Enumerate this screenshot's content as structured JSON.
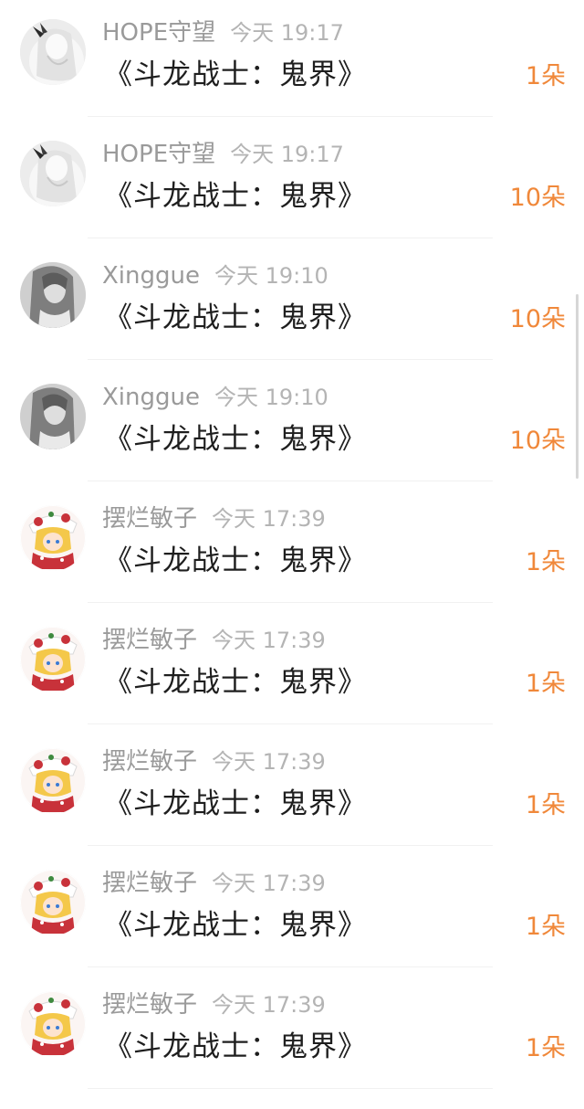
{
  "gift_list": [
    {
      "user": "HOPE守望",
      "time": "今天 19:17",
      "book": "《斗龙战士：鬼界》",
      "amount": "1朵",
      "avatar_icon": "white-haired-girl-avatar"
    },
    {
      "user": "HOPE守望",
      "time": "今天 19:17",
      "book": "《斗龙战士：鬼界》",
      "amount": "10朵",
      "avatar_icon": "white-haired-girl-avatar"
    },
    {
      "user": "Xinggue",
      "time": "今天 19:10",
      "book": "《斗龙战士：鬼界》",
      "amount": "10朵",
      "avatar_icon": "dark-haired-girl-avatar"
    },
    {
      "user": "Xinggue",
      "time": "今天 19:10",
      "book": "《斗龙战士：鬼界》",
      "amount": "10朵",
      "avatar_icon": "dark-haired-girl-avatar"
    },
    {
      "user": "摆烂敏子",
      "time": "今天 17:39",
      "book": "《斗龙战士：鬼界》",
      "amount": "1朵",
      "avatar_icon": "blonde-anime-avatar"
    },
    {
      "user": "摆烂敏子",
      "time": "今天 17:39",
      "book": "《斗龙战士：鬼界》",
      "amount": "1朵",
      "avatar_icon": "blonde-anime-avatar"
    },
    {
      "user": "摆烂敏子",
      "time": "今天 17:39",
      "book": "《斗龙战士：鬼界》",
      "amount": "1朵",
      "avatar_icon": "blonde-anime-avatar"
    },
    {
      "user": "摆烂敏子",
      "time": "今天 17:39",
      "book": "《斗龙战士：鬼界》",
      "amount": "1朵",
      "avatar_icon": "blonde-anime-avatar"
    },
    {
      "user": "摆烂敏子",
      "time": "今天 17:39",
      "book": "《斗龙战士：鬼界》",
      "amount": "1朵",
      "avatar_icon": "blonde-anime-avatar"
    }
  ],
  "colors": {
    "amount": "#f0883a",
    "username": "#9a9a9a",
    "timestamp": "#b4b4b4",
    "title": "#1e1e1e"
  }
}
